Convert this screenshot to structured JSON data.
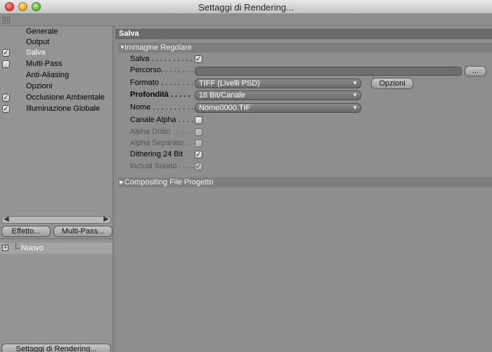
{
  "window": {
    "title": "Settaggi di Rendering..."
  },
  "sidebar": {
    "items": [
      {
        "label": "Generale",
        "checked": null
      },
      {
        "label": "Output",
        "checked": null
      },
      {
        "label": "Salva",
        "checked": true,
        "selected": true
      },
      {
        "label": "Multi-Pass",
        "checked": false
      },
      {
        "label": "Anti-Aliasing",
        "checked": null
      },
      {
        "label": "Opzioni",
        "checked": null
      },
      {
        "label": "Occlusione Ambientale",
        "checked": true
      },
      {
        "label": "Illuminazione Globale",
        "checked": true
      }
    ],
    "effect_button": "Effetto...",
    "multipass_button": "Multi-Pass...",
    "tree_item": "Nuovo",
    "bottom_button": "Settaggi di Rendering..."
  },
  "main": {
    "section_title": "Salva",
    "group_regular": "Immagine Regolare",
    "group_compositing": "Compositing File Progetto",
    "check_mark": "✓",
    "rows": {
      "salva": "Salva . . . . . . . . . .",
      "percorso": "Percorso. . . . . . . . .",
      "formato": "Formato . . . . . . . .",
      "profondita": "Profondità . . . . .",
      "nome": "Nome . . . . . . . . . .",
      "canale_alpha": "Canale Alpha . . . .",
      "alpha_dritto": "Alpha Dritto . . . . .",
      "alpha_separato": "Alpha Separato . .",
      "dithering": "Dithering 24 Bit",
      "includi_suono": "Includi Suono . . . ."
    },
    "formato_value": "TIFF (Livelli PSD)",
    "profondita_value": "16 Bit/Canale",
    "nome_value": "Nome0000.TIF",
    "opzioni_button": "Opzioni",
    "browse_button": "...",
    "states": {
      "salva": true,
      "canale_alpha": false,
      "alpha_dritto": false,
      "alpha_separato": false,
      "dithering": true,
      "includi_suono": true
    }
  }
}
